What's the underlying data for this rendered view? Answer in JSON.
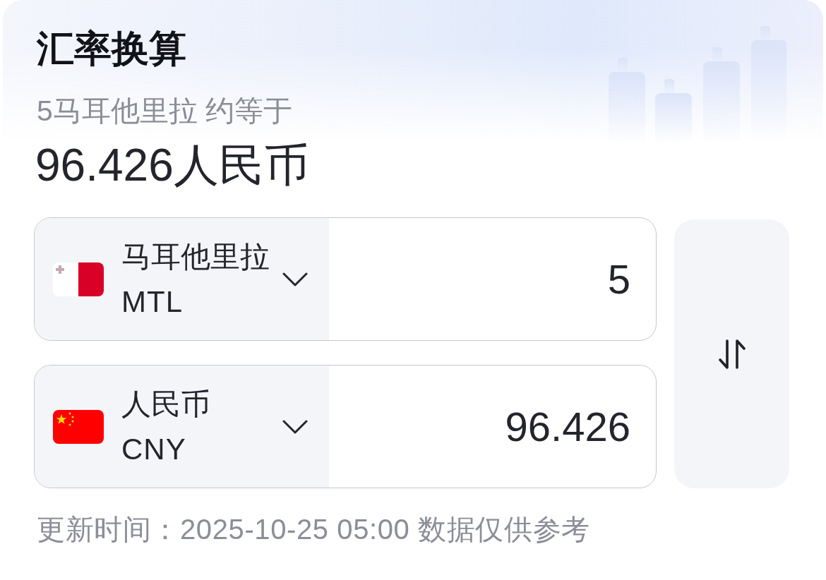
{
  "title": "汇率换算",
  "summary": {
    "text": "5马耳他里拉 约等于",
    "result": "96.426人民币"
  },
  "converter_rows": [
    {
      "kind": "malta",
      "currency_name": "马耳他里拉",
      "code": "MTL",
      "amount": "5"
    },
    {
      "kind": "china",
      "currency_name": "人民币",
      "code": "CNY",
      "amount": "96.426"
    }
  ],
  "footer_note": "更新时间：2025-10-25 05:00 数据仅供参考"
}
